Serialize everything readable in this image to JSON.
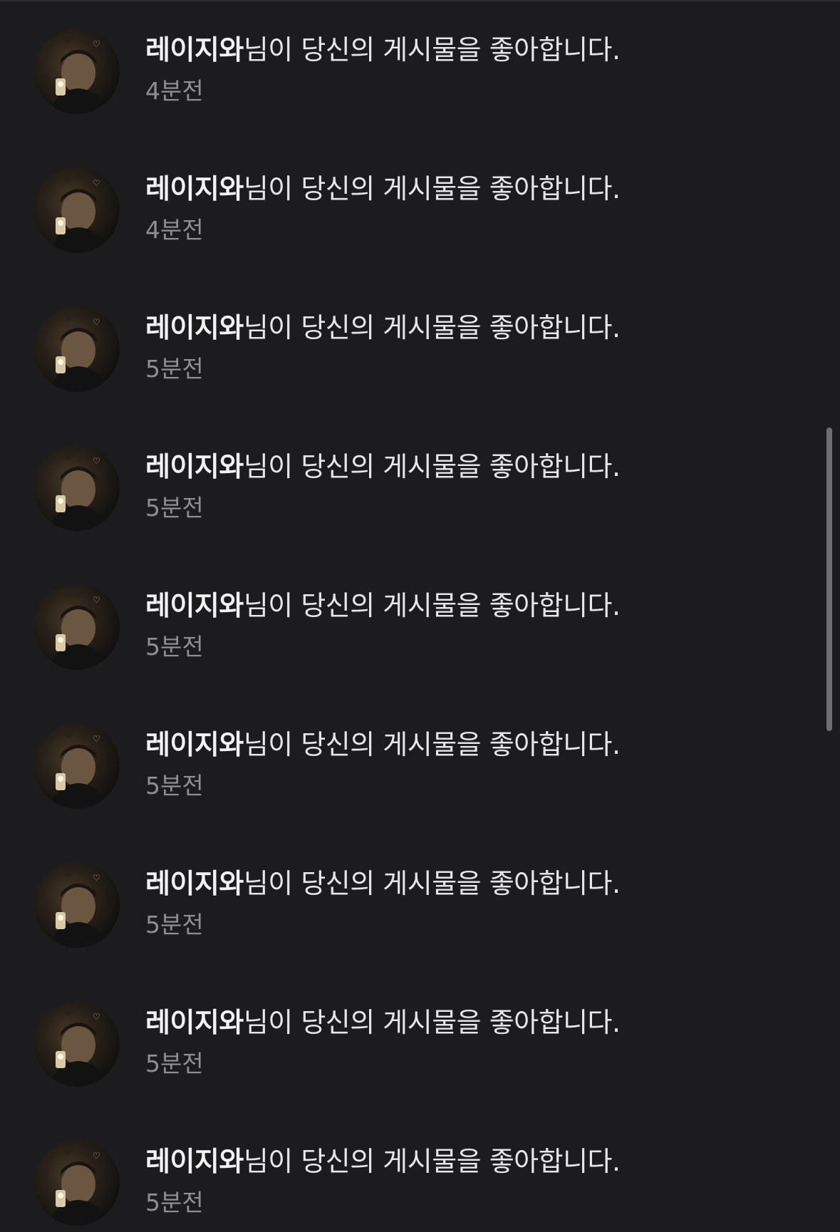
{
  "notifications": [
    {
      "username": "레이지와",
      "message": "님이 당신의 게시물을 좋아합니다.",
      "time": "4분전"
    },
    {
      "username": "레이지와",
      "message": "님이 당신의 게시물을 좋아합니다.",
      "time": "4분전"
    },
    {
      "username": "레이지와",
      "message": "님이 당신의 게시물을 좋아합니다.",
      "time": "5분전"
    },
    {
      "username": "레이지와",
      "message": "님이 당신의 게시물을 좋아합니다.",
      "time": "5분전"
    },
    {
      "username": "레이지와",
      "message": "님이 당신의 게시물을 좋아합니다.",
      "time": "5분전"
    },
    {
      "username": "레이지와",
      "message": "님이 당신의 게시물을 좋아합니다.",
      "time": "5분전"
    },
    {
      "username": "레이지와",
      "message": "님이 당신의 게시물을 좋아합니다.",
      "time": "5분전"
    },
    {
      "username": "레이지와",
      "message": "님이 당신의 게시물을 좋아합니다.",
      "time": "5분전"
    },
    {
      "username": "레이지와",
      "message": "님이 당신의 게시물을 좋아합니다.",
      "time": "5분전"
    }
  ],
  "theme": {
    "background": "#1c1c1e",
    "text": "#e6e6e6",
    "secondary_text": "#8e8e93",
    "scrollbar": "#6e6e73"
  }
}
